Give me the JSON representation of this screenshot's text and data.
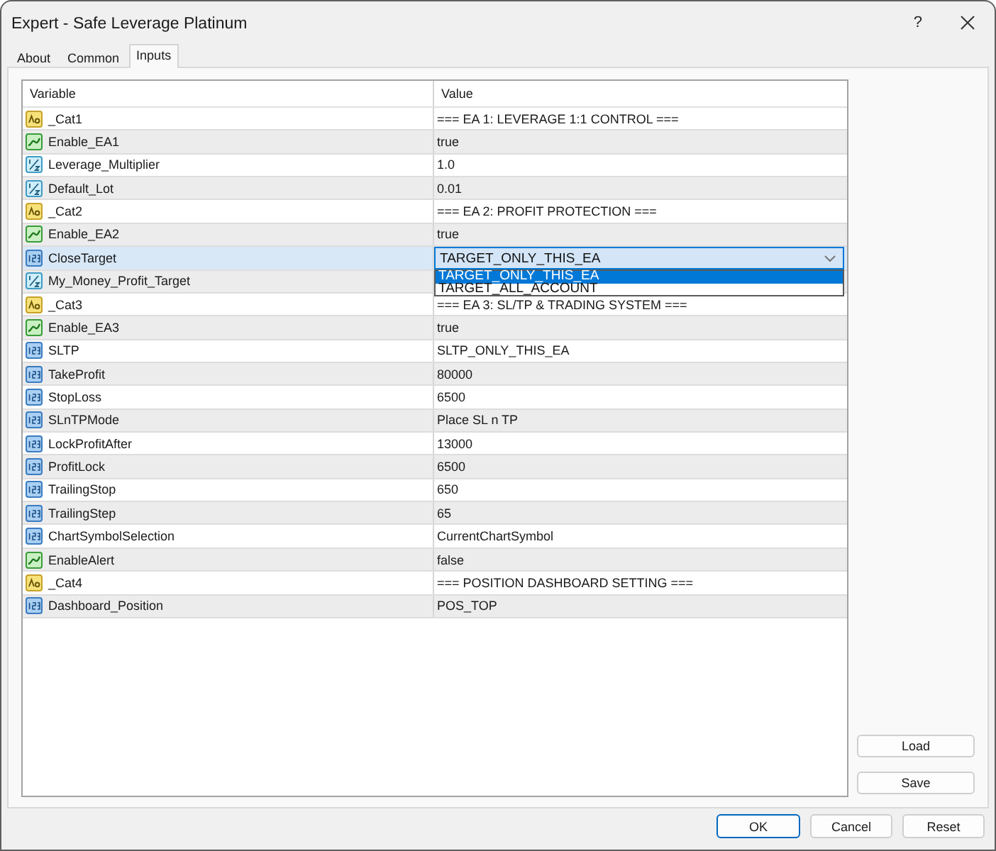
{
  "window": {
    "title": "Expert - Safe Leverage Platinum",
    "help_label": "?"
  },
  "tabs": [
    {
      "label": "About",
      "selected": false
    },
    {
      "label": "Common",
      "selected": false
    },
    {
      "label": "Inputs",
      "selected": true
    }
  ],
  "table": {
    "columns": [
      "Variable",
      "Value"
    ],
    "rows": [
      {
        "kind": "text",
        "variable": "_Cat1",
        "value": "=== EA 1: LEVERAGE 1:1 CONTROL ===",
        "selected": false
      },
      {
        "kind": "bool",
        "variable": "Enable_EA1",
        "value": "true",
        "selected": false
      },
      {
        "kind": "fraction",
        "variable": "Leverage_Multiplier",
        "value": "1.0",
        "selected": false
      },
      {
        "kind": "fraction",
        "variable": "Default_Lot",
        "value": "0.01",
        "selected": false
      },
      {
        "kind": "text",
        "variable": "_Cat2",
        "value": "=== EA 2: PROFIT PROTECTION ===",
        "selected": false
      },
      {
        "kind": "bool",
        "variable": "Enable_EA2",
        "value": "true",
        "selected": false
      },
      {
        "kind": "number",
        "variable": "CloseTarget",
        "selected": true,
        "dropdown": {
          "value": "TARGET_ONLY_THIS_EA",
          "expanded": true,
          "options": [
            {
              "label": "TARGET_ONLY_THIS_EA",
              "selected": true
            },
            {
              "label": "TARGET_ALL_ACCOUNT",
              "selected": false
            }
          ]
        }
      },
      {
        "kind": "fraction",
        "variable": "My_Money_Profit_Target",
        "selected": false
      },
      {
        "kind": "text",
        "variable": "_Cat3",
        "value": "=== EA 3: SL/TP & TRADING SYSTEM ===",
        "selected": false
      },
      {
        "kind": "bool",
        "variable": "Enable_EA3",
        "value": "true",
        "selected": false
      },
      {
        "kind": "number",
        "variable": "SLTP",
        "value": "SLTP_ONLY_THIS_EA",
        "selected": false
      },
      {
        "kind": "number",
        "variable": "TakeProfit",
        "value": "80000",
        "selected": false
      },
      {
        "kind": "number",
        "variable": "StopLoss",
        "value": "6500",
        "selected": false
      },
      {
        "kind": "number",
        "variable": "SLnTPMode",
        "value": "Place SL n TP",
        "selected": false
      },
      {
        "kind": "number",
        "variable": "LockProfitAfter",
        "value": "13000",
        "selected": false
      },
      {
        "kind": "number",
        "variable": "ProfitLock",
        "value": "6500",
        "selected": false
      },
      {
        "kind": "number",
        "variable": "TrailingStop",
        "value": "650",
        "selected": false
      },
      {
        "kind": "number",
        "variable": "TrailingStep",
        "value": "65",
        "selected": false
      },
      {
        "kind": "number",
        "variable": "ChartSymbolSelection",
        "value": "CurrentChartSymbol",
        "selected": false
      },
      {
        "kind": "bool",
        "variable": "EnableAlert",
        "value": "false",
        "selected": false
      },
      {
        "kind": "text",
        "variable": "_Cat4",
        "value": "=== POSITION DASHBOARD SETTING ===",
        "selected": false
      },
      {
        "kind": "number",
        "variable": "Dashboard_Position",
        "value": "POS_TOP",
        "selected": false
      }
    ]
  },
  "side_buttons": [
    "Load",
    "Save"
  ],
  "buttons": [
    {
      "label": "OK",
      "default": true
    },
    {
      "label": "Cancel",
      "default": false
    },
    {
      "label": "Reset",
      "default": false
    }
  ]
}
